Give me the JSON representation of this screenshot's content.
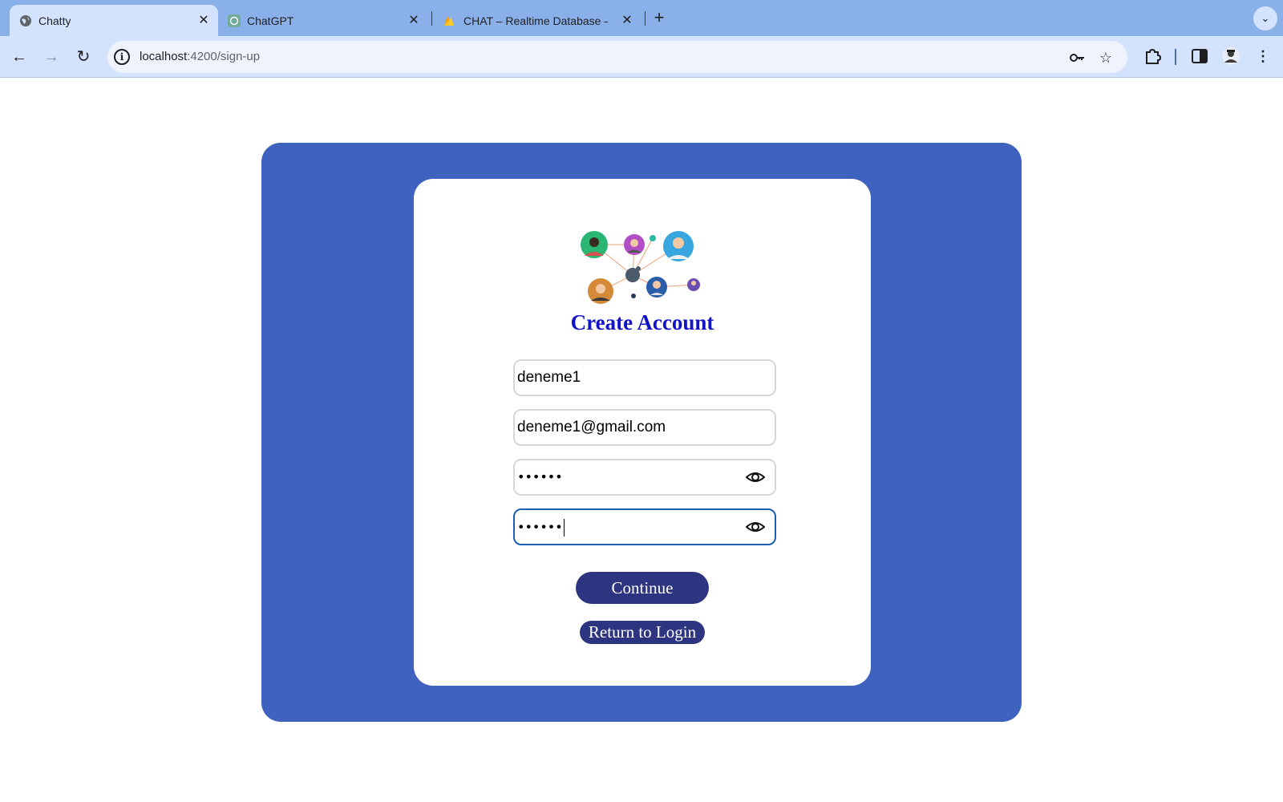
{
  "browser": {
    "tabs": [
      {
        "title": "Chatty",
        "favicon": "globe-icon",
        "active": true
      },
      {
        "title": "ChatGPT",
        "favicon": "chatgpt-icon",
        "active": false
      },
      {
        "title": "CHAT – Realtime Database –",
        "favicon": "firebase-icon",
        "active": false
      }
    ],
    "close_glyph": "✕",
    "new_tab_glyph": "+",
    "address": {
      "host": "localhost",
      "path": ":4200/sign-up"
    }
  },
  "form": {
    "title": "Create Account",
    "username_value": "deneme1",
    "email_value": "deneme1@gmail.com",
    "password_mask": "••••••",
    "confirm_mask": "••••••",
    "continue_label": "Continue",
    "return_label": "Return to Login"
  },
  "colors": {
    "outer_panel": "#3e62bd",
    "heading": "#1212c8",
    "button": "#2e3580",
    "focus_border": "#1b5fb5"
  }
}
